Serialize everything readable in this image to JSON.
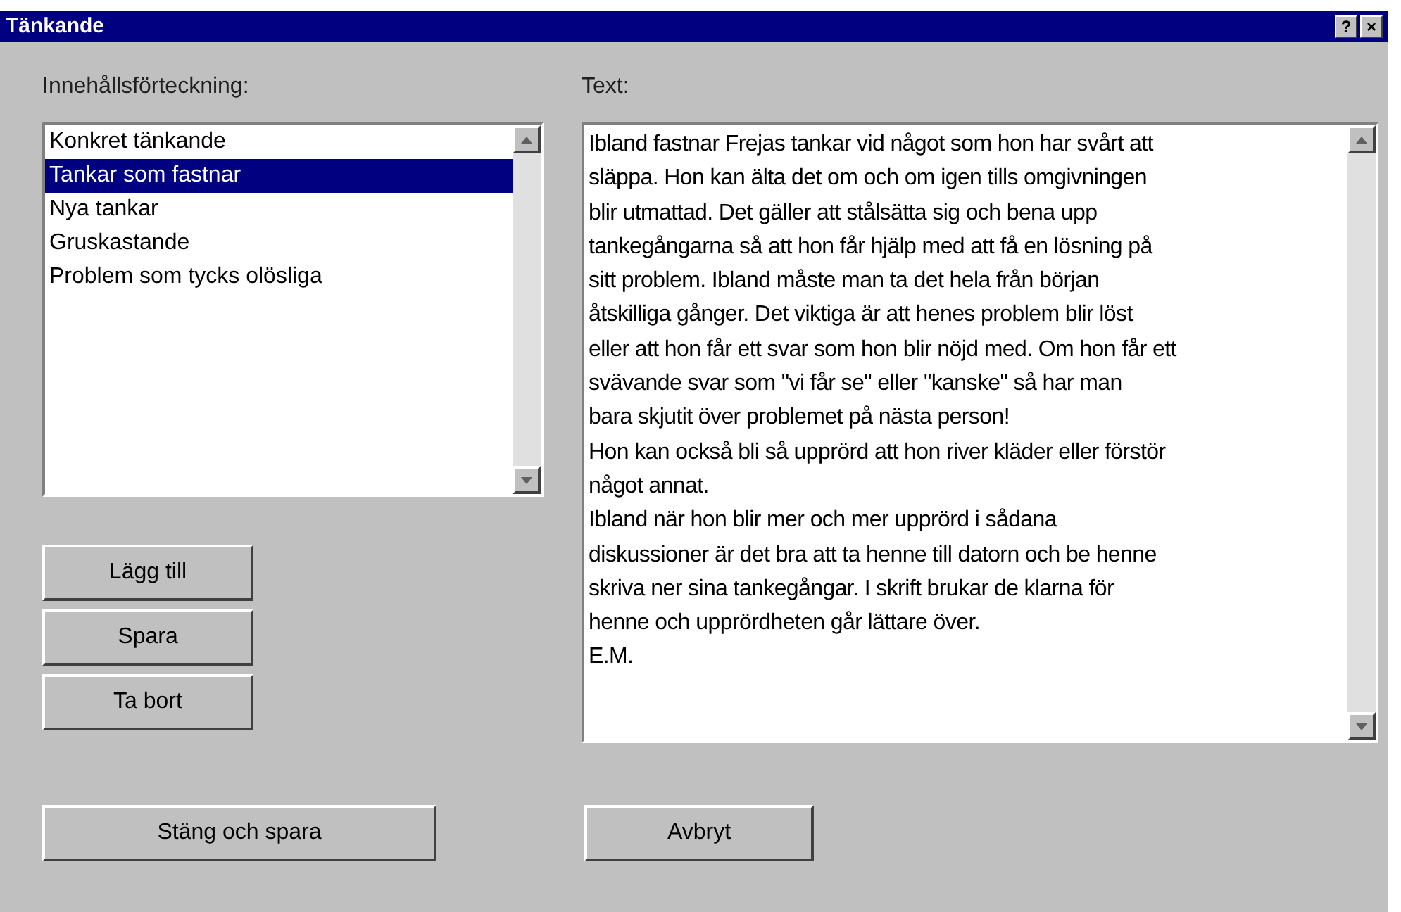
{
  "window": {
    "title": "Tänkande",
    "title_buttons": [
      "?",
      "×"
    ]
  },
  "contents": {
    "label": "Innehållsförteckning:",
    "items": [
      {
        "label": "Konkret tänkande",
        "selected": false
      },
      {
        "label": "Tankar som fastnar",
        "selected": true
      },
      {
        "label": "Nya tankar",
        "selected": false
      },
      {
        "label": "Gruskastande",
        "selected": false
      },
      {
        "label": "Problem som tycks olösliga",
        "selected": false
      }
    ]
  },
  "side_buttons": [
    "Lägg till",
    "Spara",
    "Ta bort"
  ],
  "text": {
    "label": "Text:",
    "lines": [
      "Ibland fastnar Frejas tankar vid något som hon har svårt att",
      "släppa. Hon kan älta det om och om igen tills omgivningen",
      "blir utmattad. Det gäller att stålsätta sig och bena upp",
      "tankegångarna så att hon får hjälp med att få en lösning på",
      "sitt problem. Ibland måste man ta det hela från början",
      "åtskilliga gånger. Det viktiga är att henes problem blir löst",
      "eller att hon får ett svar som hon blir nöjd med. Om hon får ett",
      "svävande svar som \"vi får se\" eller \"kanske\" så har man",
      "bara skjutit över problemet på nästa person!",
      "Hon kan också bli så upprörd att hon river kläder eller förstör",
      "något annat.",
      "Ibland när hon blir mer och mer upprörd i sådana",
      "diskussioner är det bra att ta henne till datorn och be henne",
      "skriva ner sina tankegångar. I skrift brukar de klarna för",
      "henne och upprördheten går lättare över.",
      "E.M."
    ]
  },
  "bottom_buttons": [
    "Stäng och spara",
    "Avbryt"
  ]
}
